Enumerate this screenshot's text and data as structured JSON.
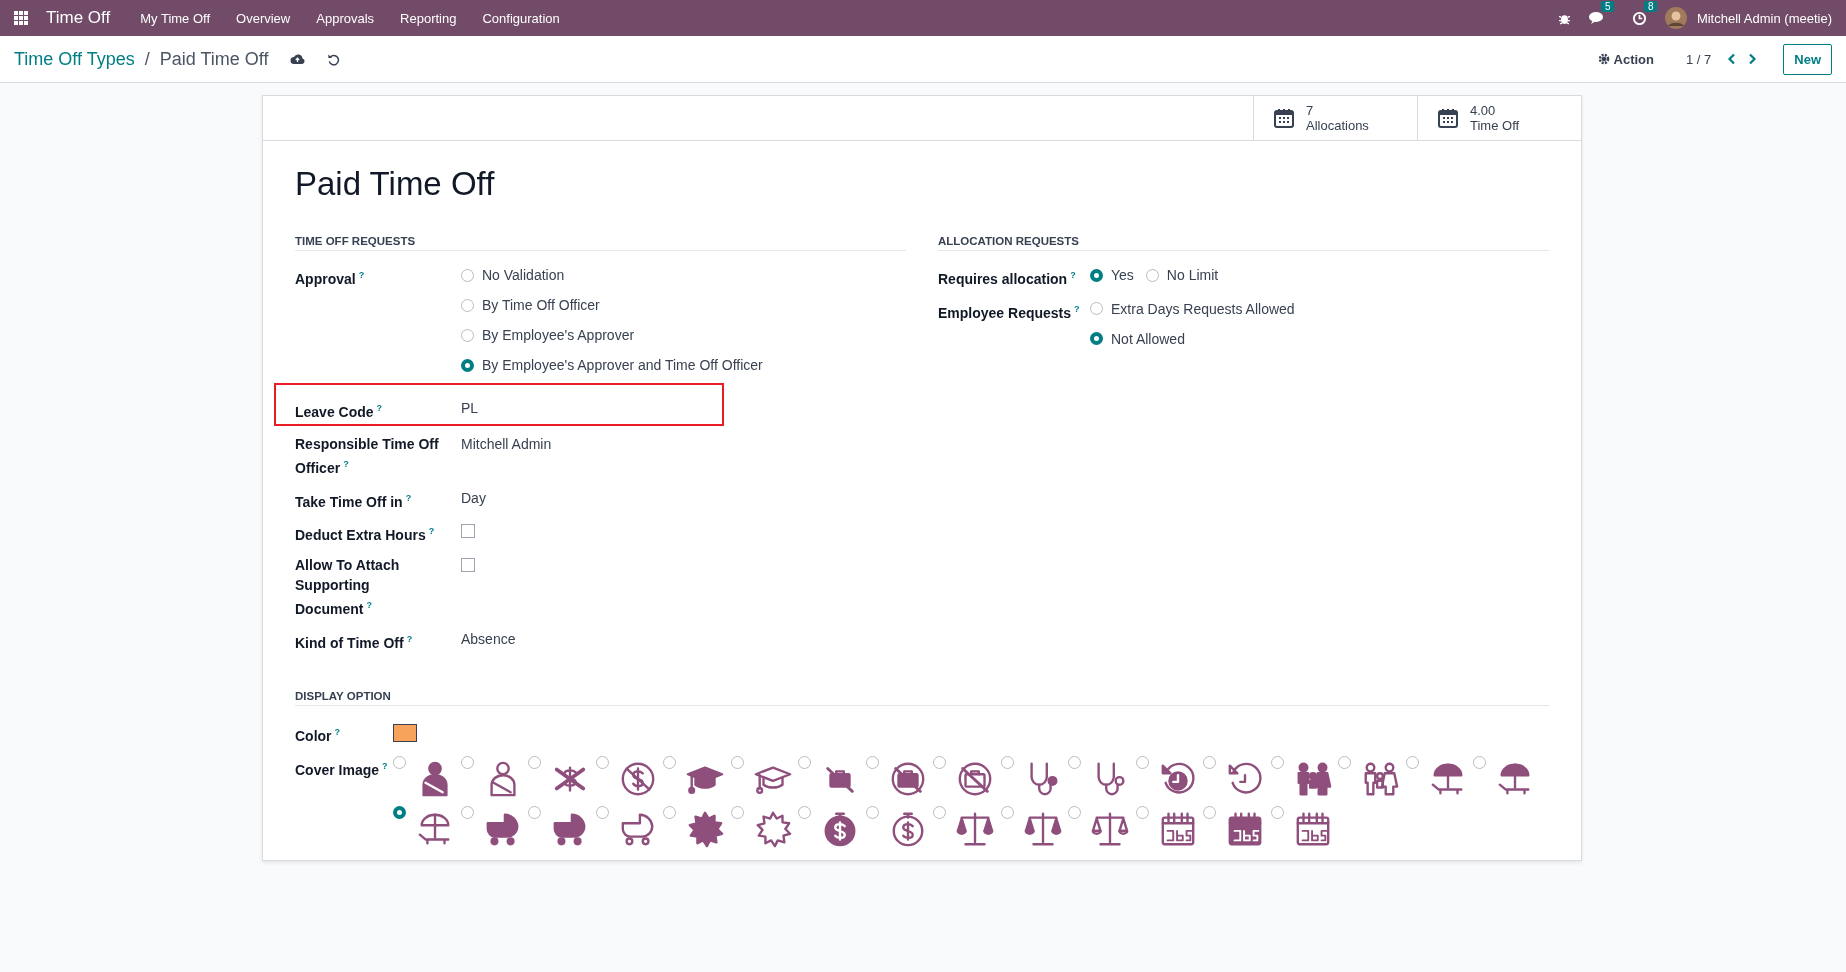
{
  "navbar": {
    "app_name": "Time Off",
    "menu": [
      "My Time Off",
      "Overview",
      "Approvals",
      "Reporting",
      "Configuration"
    ],
    "messages_count": "5",
    "activities_count": "8",
    "user": "Mitchell Admin (meetie)"
  },
  "control_panel": {
    "breadcrumb": "Time Off Types",
    "separator": "/",
    "current": "Paid Time Off",
    "action": "Action",
    "pager": "1 / 7",
    "new_button": "New"
  },
  "smart_buttons": [
    {
      "value": "7",
      "label": "Allocations"
    },
    {
      "value": "4.00",
      "label": "Time Off"
    }
  ],
  "title": "Paid Time Off",
  "left_section": {
    "heading": "TIME OFF REQUESTS",
    "fields": [
      {
        "kind": "radio",
        "label": "Approval",
        "help": "?",
        "highlighted": false,
        "options": [
          {
            "label": "No Validation",
            "selected": false
          },
          {
            "label": "By Time Off Officer",
            "selected": false
          },
          {
            "label": "By Employee's Approver",
            "selected": false
          },
          {
            "label": "By Employee's Approver and Time Off Officer",
            "selected": true
          }
        ]
      },
      {
        "kind": "text",
        "label": "Leave Code",
        "help": "?",
        "highlighted": true,
        "value": "PL"
      },
      {
        "kind": "text",
        "label": "Responsible Time Off Officer",
        "help": "?",
        "highlighted": false,
        "value": "Mitchell Admin"
      },
      {
        "kind": "text",
        "label": "Take Time Off in",
        "help": "?",
        "highlighted": false,
        "value": "Day"
      },
      {
        "kind": "checkbox",
        "label": "Deduct Extra Hours",
        "help": "?",
        "highlighted": false,
        "checked": false
      },
      {
        "kind": "checkbox",
        "label": "Allow To Attach Supporting Document",
        "help": "?",
        "highlighted": false,
        "checked": false
      },
      {
        "kind": "text",
        "label": "Kind of Time Off",
        "help": "?",
        "highlighted": false,
        "value": "Absence"
      }
    ]
  },
  "right_section": {
    "heading": "ALLOCATION REQUESTS",
    "fields": [
      {
        "kind": "radio_inline",
        "label": "Requires allocation",
        "help": "?",
        "options": [
          {
            "label": "Yes",
            "selected": true
          },
          {
            "label": "No Limit",
            "selected": false
          }
        ]
      },
      {
        "kind": "radio",
        "label": "Employee Requests",
        "help": "?",
        "options": [
          {
            "label": "Extra Days Requests Allowed",
            "selected": false
          },
          {
            "label": "Not Allowed",
            "selected": true
          }
        ]
      }
    ]
  },
  "display_section": {
    "heading": "DISPLAY OPTION",
    "color_label": "Color",
    "color_help": "?",
    "color": "#f7a35c",
    "cover_label": "Cover Image",
    "cover_help": "?",
    "cover_images": [
      {
        "selected": false
      },
      {
        "selected": false
      },
      {
        "selected": false
      },
      {
        "selected": false
      },
      {
        "selected": false
      },
      {
        "selected": false
      },
      {
        "selected": false
      },
      {
        "selected": false
      },
      {
        "selected": false
      },
      {
        "selected": false
      },
      {
        "selected": false
      },
      {
        "selected": false
      },
      {
        "selected": false
      },
      {
        "selected": false
      },
      {
        "selected": false
      },
      {
        "selected": false
      },
      {
        "selected": false
      },
      {
        "selected": true
      },
      {
        "selected": false
      },
      {
        "selected": false
      },
      {
        "selected": false
      },
      {
        "selected": false
      },
      {
        "selected": false
      },
      {
        "selected": false
      },
      {
        "selected": false
      },
      {
        "selected": false
      },
      {
        "selected": false
      },
      {
        "selected": false
      },
      {
        "selected": false
      },
      {
        "selected": false
      },
      {
        "selected": false
      }
    ]
  }
}
